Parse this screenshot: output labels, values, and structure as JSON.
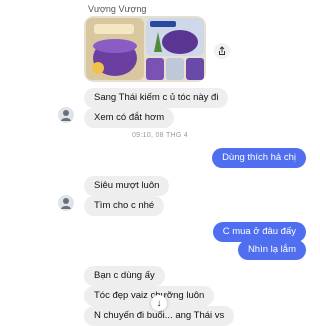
{
  "conversation": {
    "sender_name": "Vượng Vượng",
    "timestamp": "09:10, 08 THG 4",
    "messages": [
      {
        "text": "Sang Thái kiếm c ủ tóc này đi"
      },
      {
        "text": "Xem có đắt hơm"
      },
      {
        "text": "Dùng thích hả chị"
      },
      {
        "text": "Siêu mượt luôn"
      },
      {
        "text": "Tìm cho c nhé"
      },
      {
        "text": "C mua ở đâu đấy"
      },
      {
        "text": "Nhìn lạ lắm"
      },
      {
        "text": "Bạn c dùng ấy"
      },
      {
        "text": "Tóc đẹp vaiz chưỡng luôn"
      },
      {
        "text": "N chuyến đi buổi... ang Thái vs"
      }
    ]
  },
  "icons": {
    "share": "share-icon",
    "avatar": "avatar-icon",
    "scroll_down": "arrow-down-icon"
  },
  "colors": {
    "outgoing_bubble": "#4f6ef0",
    "incoming_bubble": "#eeeeee"
  }
}
